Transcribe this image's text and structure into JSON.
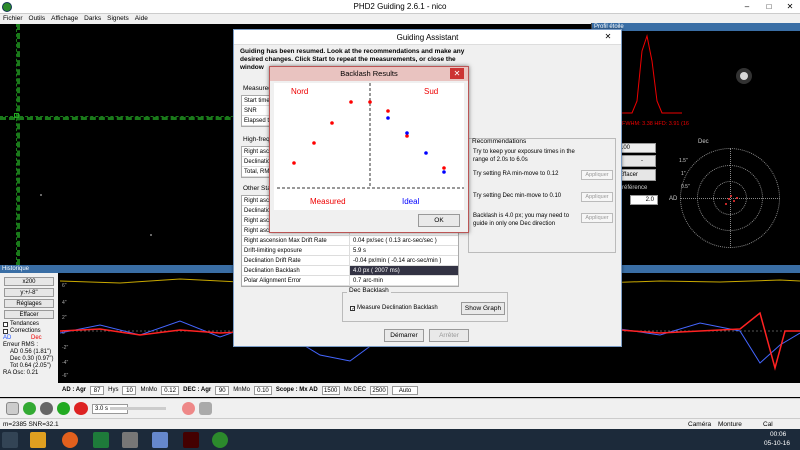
{
  "window": {
    "title": "PHD2 Guiding 2.6.1 - nico"
  },
  "menu": [
    "Fichier",
    "Outils",
    "Affichage",
    "Darks",
    "Signets",
    "Aide"
  ],
  "profile": {
    "title": "Profil étoile",
    "footer": "FWHM: 3.38  HFD: 3.91 (16"
  },
  "target_panel": {
    "dec_label": "Dec",
    "ra_label": "AD",
    "ticks": [
      "1.5\"",
      "1\"",
      "0.5\""
    ],
    "menu_value": "100",
    "clear_label": "Effacer",
    "reference_label": "référence",
    "scale_value": "2.0"
  },
  "history": {
    "title": "Historique",
    "scale_x": "x200",
    "scale_y": "y:+/-8\"",
    "settings": "Réglages",
    "clear": "Effacer",
    "trends": "Tendances",
    "corrections": "Corrections",
    "ra_label": "AD",
    "dec_label": "Dec",
    "rms_title": "Erreur RMS :",
    "rms_ra": "AD 0.56 (1.81\")",
    "rms_dec": "Dec 0.30 (0.97\")",
    "rms_tot": "Tot 0.64 (2.05\")",
    "ra_osc": "RA Osc: 0.21",
    "y_ticks": [
      "6\"",
      "4\"",
      "2\"",
      "0\"",
      "-2\"",
      "-4\"",
      "-6\""
    ]
  },
  "bottom_bar": {
    "ad_label": "AD : Agr",
    "ad_agr": "87",
    "hys_label": "Hys",
    "hys": "10",
    "minmo_label": "MnMo",
    "minmo": "0.12",
    "dec_label": "DEC : Agr",
    "dec_agr": "90",
    "dec_minmo_label": "MnMo",
    "dec_minmo": "0.10",
    "scope_label": "Scope : Mx AD",
    "mx_ad": "1500",
    "mx_dec_label": "Mx DEC",
    "mx_dec": "2500",
    "mode": "Auto"
  },
  "toolbar": {
    "exposure": "3.0 s"
  },
  "statusbar": {
    "left": "m=2385 SNR=32.1",
    "camera": "Caméra",
    "mount": "Monture",
    "cal": "Cal"
  },
  "taskbar": {
    "time": "00:06",
    "date": "05-10-16"
  },
  "guiding_assistant": {
    "title": "Guiding Assistant",
    "intro": "Guiding has been resumed. Look at the recommendations and make any desired changes.  Click Start to repeat the measurements, or close the window",
    "measured_section": "Measured",
    "measured_rows": [
      {
        "k": "Start time",
        "v": ""
      },
      {
        "k": "SNR",
        "v": ""
      },
      {
        "k": "Elapsed ti",
        "v": ""
      }
    ],
    "hf_section": "High-frequ",
    "hf_rows": [
      {
        "k": "Right ascen",
        "v": ""
      },
      {
        "k": "Declination",
        "v": ""
      },
      {
        "k": "Total, RMS",
        "v": ""
      }
    ],
    "other_section": "Other Stat",
    "other_rows": [
      {
        "k": "Right ascen",
        "v": ""
      },
      {
        "k": "Declination",
        "v": ""
      },
      {
        "k": "Right ascen",
        "v": ""
      },
      {
        "k": "Right ascen",
        "v": ""
      },
      {
        "k": "Right ascension Max Drift Rate",
        "v": "0.04 px/sec ( 0.13 arc-sec/sec )"
      },
      {
        "k": "Drift-limiting exposure",
        "v": "5.9 s"
      },
      {
        "k": "Declination Drift Rate",
        "v": "-0.04 px/min ( -0.14 arc-sec/min )"
      },
      {
        "k": "Declination Backlash",
        "v": "4.0 px ( 2007 ms)"
      },
      {
        "k": "Polar Alignment Error",
        "v": "0.7 arc-min"
      }
    ],
    "recommendations": {
      "title": "Recommendations",
      "exposure": "Try to keep your exposure times in the range of 2.0s to 6.0s",
      "ra": "Try setting RA min-move to 0.12",
      "dec": "Try setting Dec min-move to 0.10",
      "backlash": "Backlash is 4.0 px; you may need to guide in only one Dec direction",
      "apply": "Appliquer"
    },
    "dec_backlash": {
      "title": "Dec Backlash",
      "checkbox": "Measure Declination Backlash",
      "show_graph": "Show Graph"
    },
    "start": "Démarrer",
    "stop": "Arrêter"
  },
  "backlash_results": {
    "title": "Backlash Results",
    "north": "Nord",
    "south": "Sud",
    "measured": "Measured",
    "ideal": "Ideal",
    "ok": "OK",
    "close": "✕",
    "colors": {
      "measured": "#ff0000",
      "ideal": "#0000ff"
    }
  }
}
